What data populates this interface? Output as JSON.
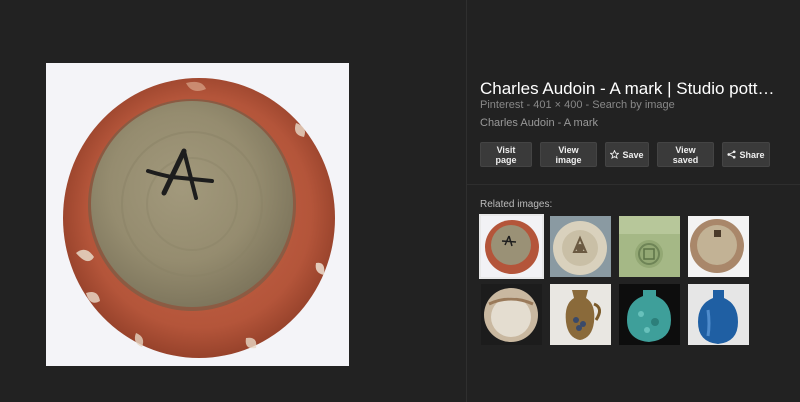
{
  "result": {
    "title": "Charles Audoin - A mark | Studio pott…",
    "source": "Pinterest",
    "dimensions": "401 × 400",
    "separator": " - ",
    "search_by_image": "Search by image",
    "subtitle": "Charles Audoin - A mark"
  },
  "actions": {
    "visit_page": "Visit page",
    "view_image": "View image",
    "save": "Save",
    "view_saved": "View saved",
    "share": "Share"
  },
  "related": {
    "label": "Related images:"
  },
  "icons": {
    "save": "star-icon",
    "share": "share-icon"
  },
  "colors": {
    "background": "#222222",
    "button": "#3a3a3a",
    "title": "#ffffff"
  }
}
